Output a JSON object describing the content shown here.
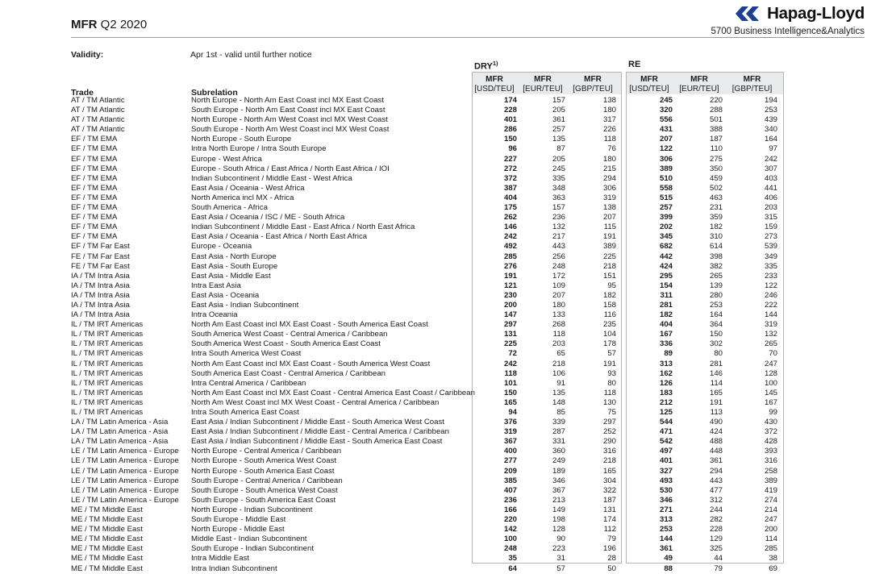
{
  "header": {
    "title_strong": "MFR",
    "title_rest": " Q2 2020",
    "brand_name": "Hapag-Lloyd",
    "brand_sub": "5700 Business Intelligence&Analytics",
    "brand_color": "#1d3f91"
  },
  "validity": {
    "label": "Validity:",
    "value": "Apr 1st - valid until further notice"
  },
  "columns": {
    "trade": "Trade",
    "subrelation": "Subrelation"
  },
  "groups": [
    {
      "id": "dry",
      "caption": "DRY",
      "caption_sup": "1)",
      "headers": [
        {
          "l1": "MFR",
          "l2": "[USD/TEU]"
        },
        {
          "l1": "MFR",
          "l2": "[EUR/TEU]"
        },
        {
          "l1": "MFR",
          "l2": "[GBP/TEU]"
        }
      ]
    },
    {
      "id": "re",
      "caption": "RE",
      "caption_sup": "",
      "headers": [
        {
          "l1": "MFR",
          "l2": "[USD/TEU]"
        },
        {
          "l1": "MFR",
          "l2": "[EUR/TEU]"
        },
        {
          "l1": "MFR",
          "l2": "[GBP/TEU]"
        }
      ]
    }
  ],
  "rows": [
    {
      "trade": "AT / TM Atlantic",
      "sub": "North Europe - North Am East Coast incl MX East Coast",
      "dry": [
        174,
        157,
        138
      ],
      "re": [
        245,
        220,
        194
      ]
    },
    {
      "trade": "AT / TM Atlantic",
      "sub": "South Europe - North Am East Coast incl MX East Coast",
      "dry": [
        228,
        205,
        180
      ],
      "re": [
        320,
        288,
        253
      ]
    },
    {
      "trade": "AT / TM Atlantic",
      "sub": "North Europe - North Am West Coast incl MX West Coast",
      "dry": [
        401,
        361,
        317
      ],
      "re": [
        556,
        501,
        439
      ]
    },
    {
      "trade": "AT / TM Atlantic",
      "sub": "South Europe - North Am West Coast incl MX West Coast",
      "dry": [
        286,
        257,
        226
      ],
      "re": [
        431,
        388,
        340
      ]
    },
    {
      "trade": "EF / TM EMA",
      "sub": "North Europe - South Europe",
      "dry": [
        150,
        135,
        118
      ],
      "re": [
        207,
        187,
        164
      ]
    },
    {
      "trade": "EF / TM EMA",
      "sub": "Intra North Europe / Intra South Europe",
      "dry": [
        96,
        87,
        76
      ],
      "re": [
        122,
        110,
        97
      ]
    },
    {
      "trade": "EF / TM EMA",
      "sub": "Europe - West Africa",
      "dry": [
        227,
        205,
        180
      ],
      "re": [
        306,
        275,
        242
      ]
    },
    {
      "trade": "EF / TM EMA",
      "sub": "Europe - South Africa / East Africa / North East Africa / IOI",
      "dry": [
        272,
        245,
        215
      ],
      "re": [
        389,
        350,
        307
      ]
    },
    {
      "trade": "EF / TM EMA",
      "sub": "Indian Subcontinent / Middle East - West Africa",
      "dry": [
        372,
        335,
        294
      ],
      "re": [
        510,
        459,
        403
      ]
    },
    {
      "trade": "EF / TM EMA",
      "sub": "East Asia / Oceania - West Africa",
      "dry": [
        387,
        348,
        306
      ],
      "re": [
        558,
        502,
        441
      ]
    },
    {
      "trade": "EF / TM EMA",
      "sub": "North America incl MX - Africa",
      "dry": [
        404,
        363,
        319
      ],
      "re": [
        515,
        463,
        406
      ]
    },
    {
      "trade": "EF / TM EMA",
      "sub": "South America - Africa",
      "dry": [
        175,
        157,
        138
      ],
      "re": [
        257,
        231,
        203
      ]
    },
    {
      "trade": "EF / TM EMA",
      "sub": "East Asia / Oceania / ISC / ME - South Africa",
      "dry": [
        262,
        236,
        207
      ],
      "re": [
        399,
        359,
        315
      ]
    },
    {
      "trade": "EF / TM EMA",
      "sub": "Indian Subcontinent / Middle East - East Africa / North East Africa",
      "dry": [
        146,
        132,
        115
      ],
      "re": [
        202,
        182,
        159
      ]
    },
    {
      "trade": "EF / TM EMA",
      "sub": "East Asia / Oceania - East Africa / North East Africa",
      "dry": [
        242,
        217,
        191
      ],
      "re": [
        345,
        310,
        273
      ]
    },
    {
      "trade": "EF / TM Far East",
      "sub": "Europe - Oceania",
      "dry": [
        492,
        443,
        389
      ],
      "re": [
        682,
        614,
        539
      ]
    },
    {
      "trade": "FE / TM Far East",
      "sub": "East Asia - North Europe",
      "dry": [
        285,
        256,
        225
      ],
      "re": [
        442,
        398,
        349
      ]
    },
    {
      "trade": "FE / TM Far East",
      "sub": "East Asia - South Europe",
      "dry": [
        276,
        248,
        218
      ],
      "re": [
        424,
        382,
        335
      ]
    },
    {
      "trade": "IA / TM Intra Asia",
      "sub": "East Asia - Middle East",
      "dry": [
        191,
        172,
        151
      ],
      "re": [
        295,
        265,
        233
      ]
    },
    {
      "trade": "IA / TM Intra Asia",
      "sub": "Intra East Asia",
      "dry": [
        121,
        109,
        95
      ],
      "re": [
        154,
        139,
        122
      ]
    },
    {
      "trade": "IA / TM Intra Asia",
      "sub": "East Asia - Oceania",
      "dry": [
        230,
        207,
        182
      ],
      "re": [
        311,
        280,
        246
      ]
    },
    {
      "trade": "IA / TM Intra Asia",
      "sub": "East Asia - Indian Subcontinent",
      "dry": [
        200,
        180,
        158
      ],
      "re": [
        281,
        253,
        222
      ]
    },
    {
      "trade": "IA / TM Intra Asia",
      "sub": "Intra Oceania",
      "dry": [
        147,
        133,
        116
      ],
      "re": [
        182,
        164,
        144
      ]
    },
    {
      "trade": "IL / TM IRT Americas",
      "sub": "North Am East Coast incl MX East Coast - South America East Coast",
      "dry": [
        297,
        268,
        235
      ],
      "re": [
        404,
        364,
        319
      ]
    },
    {
      "trade": "IL / TM IRT Americas",
      "sub": "South America West Coast - Central America / Caribbean",
      "dry": [
        131,
        118,
        104
      ],
      "re": [
        167,
        150,
        132
      ]
    },
    {
      "trade": "IL / TM IRT Americas",
      "sub": "South America West Coast - South America East Coast",
      "dry": [
        225,
        203,
        178
      ],
      "re": [
        336,
        302,
        265
      ]
    },
    {
      "trade": "IL / TM IRT Americas",
      "sub": "Intra South America West Coast",
      "dry": [
        72,
        65,
        57
      ],
      "re": [
        89,
        80,
        70
      ]
    },
    {
      "trade": "IL / TM IRT Americas",
      "sub": "North Am East Coast incl MX East Coast - South America West Coast",
      "dry": [
        242,
        218,
        191
      ],
      "re": [
        313,
        281,
        247
      ]
    },
    {
      "trade": "IL / TM IRT Americas",
      "sub": "South America East Coast - Central America / Caribbean",
      "dry": [
        118,
        106,
        93
      ],
      "re": [
        162,
        146,
        128
      ]
    },
    {
      "trade": "IL / TM IRT Americas",
      "sub": "Intra Central America / Caribbean",
      "dry": [
        101,
        91,
        80
      ],
      "re": [
        126,
        114,
        100
      ]
    },
    {
      "trade": "IL / TM IRT Americas",
      "sub": "North Am East Coast incl MX East Coast - Central America East Coast / Caribbean",
      "dry": [
        150,
        135,
        118
      ],
      "re": [
        183,
        165,
        145
      ]
    },
    {
      "trade": "IL / TM IRT Americas",
      "sub": "North Am West Coast incl MX West Coast - Central America / Caribbean",
      "dry": [
        165,
        148,
        130
      ],
      "re": [
        212,
        191,
        167
      ]
    },
    {
      "trade": "IL / TM IRT Americas",
      "sub": "Intra South America East Coast",
      "dry": [
        94,
        85,
        75
      ],
      "re": [
        125,
        113,
        99
      ]
    },
    {
      "trade": "LA / TM Latin America - Asia",
      "sub": "East Asia / Indian Subcontinent / Middle East - South America West Coast",
      "dry": [
        376,
        339,
        297
      ],
      "re": [
        544,
        490,
        430
      ]
    },
    {
      "trade": "LA / TM Latin America - Asia",
      "sub": "East Asia / Indian Subcontinent / Middle East - Central America / Caribbean",
      "dry": [
        319,
        287,
        252
      ],
      "re": [
        471,
        424,
        372
      ]
    },
    {
      "trade": "LA / TM Latin America - Asia",
      "sub": "East Asia / Indian Subcontinent / Middle East - South America East Coast",
      "dry": [
        367,
        331,
        290
      ],
      "re": [
        542,
        488,
        428
      ]
    },
    {
      "trade": "LE / TM Latin America - Europe",
      "sub": "North Europe - Central America / Caribbean",
      "dry": [
        400,
        360,
        316
      ],
      "re": [
        497,
        448,
        393
      ]
    },
    {
      "trade": "LE / TM Latin America - Europe",
      "sub": "North Europe - South America West Coast",
      "dry": [
        277,
        249,
        218
      ],
      "re": [
        401,
        361,
        316
      ]
    },
    {
      "trade": "LE / TM Latin America - Europe",
      "sub": "North Europe - South America East Coast",
      "dry": [
        209,
        189,
        165
      ],
      "re": [
        327,
        294,
        258
      ]
    },
    {
      "trade": "LE / TM Latin America - Europe",
      "sub": "South Europe - Central America / Caribbean",
      "dry": [
        385,
        346,
        304
      ],
      "re": [
        493,
        443,
        389
      ]
    },
    {
      "trade": "LE / TM Latin America - Europe",
      "sub": "South Europe - South America West Coast",
      "dry": [
        407,
        367,
        322
      ],
      "re": [
        530,
        477,
        419
      ]
    },
    {
      "trade": "LE / TM Latin America - Europe",
      "sub": "South Europe - South America East Coast",
      "dry": [
        236,
        213,
        187
      ],
      "re": [
        346,
        312,
        274
      ]
    },
    {
      "trade": "ME / TM Middle East",
      "sub": "North Europe - Indian Subcontinent",
      "dry": [
        166,
        149,
        131
      ],
      "re": [
        271,
        244,
        214
      ]
    },
    {
      "trade": "ME / TM Middle East",
      "sub": "South Europe - Middle East",
      "dry": [
        220,
        198,
        174
      ],
      "re": [
        313,
        282,
        247
      ]
    },
    {
      "trade": "ME / TM Middle East",
      "sub": "North Europe - Middle East",
      "dry": [
        142,
        128,
        112
      ],
      "re": [
        253,
        228,
        200
      ]
    },
    {
      "trade": "ME / TM Middle East",
      "sub": "Middle East - Indian Subcontinent",
      "dry": [
        100,
        90,
        79
      ],
      "re": [
        144,
        129,
        114
      ]
    },
    {
      "trade": "ME / TM Middle East",
      "sub": "South Europe - Indian Subcontinent",
      "dry": [
        248,
        223,
        196
      ],
      "re": [
        361,
        325,
        285
      ]
    },
    {
      "trade": "ME / TM Middle East",
      "sub": "Intra Middle East",
      "dry": [
        35,
        31,
        28
      ],
      "re": [
        49,
        44,
        38
      ]
    },
    {
      "trade": "ME / TM Middle East",
      "sub": "Intra Indian Subcontinent",
      "dry": [
        64,
        57,
        50
      ],
      "re": [
        88,
        79,
        69
      ]
    }
  ]
}
